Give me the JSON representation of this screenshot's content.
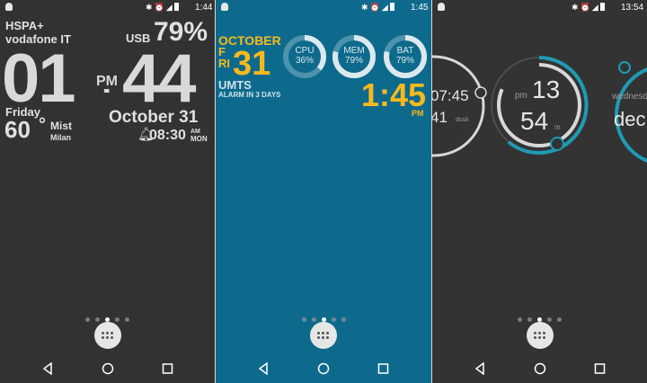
{
  "colors": {
    "accent_yellow": "#f7b91d",
    "panel2_bg": "#0e6a8c",
    "ring_teal": "#1f9bb4"
  },
  "screen1": {
    "status_time": "1:44",
    "carrier_type": "HSPA+",
    "carrier_name": "vodafone IT",
    "usb_label": "USB",
    "battery_pct": "79%",
    "hour": "01",
    "minute": "44",
    "ampm": "PM",
    "weekday": "Friday",
    "temperature": "60",
    "degree": "°",
    "weather": "Mist",
    "city": "Milan",
    "date": "October 31",
    "alarm_time": "08:30",
    "alarm_ampm": "AM",
    "alarm_day": "MON",
    "page_dots_active": 2
  },
  "screen2": {
    "status_time": "1:45",
    "month": "OCTOBER",
    "weekday": "FRI",
    "day": "31",
    "network": "UMTS",
    "alarm_note": "ALARM IN 3 DAYS",
    "gauges": [
      {
        "label": "CPU",
        "value": "36%",
        "fraction": 0.36
      },
      {
        "label": "MEM",
        "value": "79%",
        "fraction": 0.79
      },
      {
        "label": "BAT",
        "value": "79%",
        "fraction": 0.79
      }
    ],
    "time": "1:45",
    "ampm": "PM",
    "page_dots_active": 2
  },
  "screen3": {
    "status_time": "13:54",
    "left_time_top": "07:45",
    "left_time_bottom": "41",
    "left_label": "dusk",
    "ampm": "pm",
    "hour": "13",
    "minute": "54",
    "minute_unit": "m",
    "day_partial": "wednesd",
    "month_partial": "dec",
    "page_dots_active": 2
  },
  "icons": [
    "debug-icon",
    "bluetooth-icon",
    "alarm-icon",
    "signal-icon",
    "battery-icon",
    "app-drawer-icon",
    "back-icon",
    "home-icon",
    "recents-icon"
  ]
}
